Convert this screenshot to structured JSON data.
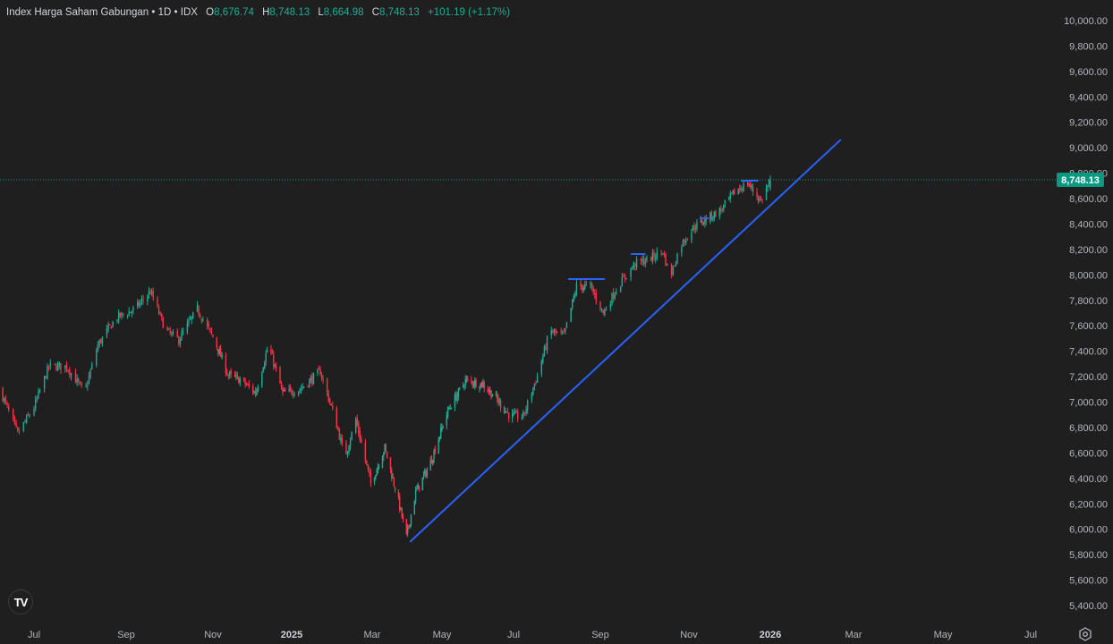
{
  "header": {
    "symbol": "Index Harga Saham Gabungan",
    "sep1": "•",
    "interval": "1D",
    "sep2": "•",
    "exchange": "IDX",
    "open_label": "O",
    "open": "8,676.74",
    "high_label": "H",
    "high": "8,748.13",
    "low_label": "L",
    "low": "8,664.98",
    "close_label": "C",
    "close": "8,748.13",
    "change": "+101.19 (+1.17%)"
  },
  "logo_text": "TV",
  "colors": {
    "background": "#1f1f1f",
    "up": "#22ab94",
    "down": "#f23645",
    "trendline": "#2962ff",
    "price_label": "#089981"
  },
  "icons": {
    "logo": "tradingview-logo-icon",
    "settings": "gear-icon"
  },
  "chart_data": {
    "type": "candlestick",
    "title": "",
    "ylim": [
      5300,
      10050
    ],
    "grid": false,
    "last_price": 8748.13,
    "last_price_label": "8,748.13",
    "y_ticks": [
      "10,000.00",
      "9,800.00",
      "9,600.00",
      "9,400.00",
      "9,200.00",
      "9,000.00",
      "8,800.00",
      "8,600.00",
      "8,400.00",
      "8,200.00",
      "8,000.00",
      "7,800.00",
      "7,600.00",
      "7,400.00",
      "7,200.00",
      "7,000.00",
      "6,800.00",
      "6,600.00",
      "6,400.00",
      "6,200.00",
      "6,000.00",
      "5,800.00",
      "5,600.00",
      "5,400.00"
    ],
    "x_ticks": [
      {
        "label": "Jul",
        "date": "2024-07-01"
      },
      {
        "label": "Sep",
        "date": "2024-09-01"
      },
      {
        "label": "Nov",
        "date": "2024-11-01"
      },
      {
        "label": "2025",
        "date": "2025-01-01",
        "bold": true
      },
      {
        "label": "Mar",
        "date": "2025-03-01"
      },
      {
        "label": "May",
        "date": "2025-05-01"
      },
      {
        "label": "Jul",
        "date": "2025-07-01"
      },
      {
        "label": "Sep",
        "date": "2025-09-01"
      },
      {
        "label": "Nov",
        "date": "2025-11-01"
      },
      {
        "label": "2026",
        "date": "2026-01-01",
        "bold": true
      },
      {
        "label": "Mar",
        "date": "2026-03-01"
      },
      {
        "label": "May",
        "date": "2026-05-01"
      },
      {
        "label": "Jul",
        "date": "2026-07-01"
      }
    ],
    "close_series": [
      [
        "2024-06-08",
        7100
      ],
      [
        "2024-06-20",
        6750
      ],
      [
        "2024-07-01",
        6960
      ],
      [
        "2024-07-11",
        7280
      ],
      [
        "2024-07-23",
        7280
      ],
      [
        "2024-08-04",
        7070
      ],
      [
        "2024-08-13",
        7450
      ],
      [
        "2024-08-25",
        7660
      ],
      [
        "2024-09-07",
        7730
      ],
      [
        "2024-09-18",
        7870
      ],
      [
        "2024-09-29",
        7560
      ],
      [
        "2024-10-08",
        7490
      ],
      [
        "2024-10-21",
        7730
      ],
      [
        "2024-11-02",
        7490
      ],
      [
        "2024-11-13",
        7210
      ],
      [
        "2024-11-23",
        7170
      ],
      [
        "2024-12-04",
        7070
      ],
      [
        "2024-12-14",
        7450
      ],
      [
        "2024-12-25",
        7070
      ],
      [
        "2025-01-07",
        7100
      ],
      [
        "2025-01-22",
        7240
      ],
      [
        "2025-02-02",
        6860
      ],
      [
        "2025-02-09",
        6570
      ],
      [
        "2025-02-17",
        6860
      ],
      [
        "2025-02-28",
        6360
      ],
      [
        "2025-03-12",
        6640
      ],
      [
        "2025-03-24",
        6220
      ],
      [
        "2025-03-31",
        5940
      ],
      [
        "2025-04-08",
        6290
      ],
      [
        "2025-04-20",
        6500
      ],
      [
        "2025-05-06",
        6930
      ],
      [
        "2025-05-21",
        7170
      ],
      [
        "2025-06-05",
        7140
      ],
      [
        "2025-06-16",
        7030
      ],
      [
        "2025-06-28",
        6890
      ],
      [
        "2025-07-08",
        6890
      ],
      [
        "2025-07-18",
        7210
      ],
      [
        "2025-07-27",
        7560
      ],
      [
        "2025-08-06",
        7520
      ],
      [
        "2025-08-15",
        7910
      ],
      [
        "2025-08-25",
        7910
      ],
      [
        "2025-09-03",
        7700
      ],
      [
        "2025-09-13",
        7910
      ],
      [
        "2025-09-25",
        8090
      ],
      [
        "2025-10-04",
        8120
      ],
      [
        "2025-10-14",
        8190
      ],
      [
        "2025-10-19",
        7980
      ],
      [
        "2025-10-26",
        8230
      ],
      [
        "2025-11-04",
        8370
      ],
      [
        "2025-11-14",
        8440
      ],
      [
        "2025-11-25",
        8510
      ],
      [
        "2025-12-05",
        8650
      ],
      [
        "2025-12-15",
        8720
      ],
      [
        "2025-12-25",
        8580
      ],
      [
        "2026-01-01",
        8748.13
      ]
    ],
    "drawings": {
      "trendline": {
        "start": [
          "2025-04-03",
          5900
        ],
        "end": [
          "2026-02-20",
          9064
        ]
      },
      "horizontal_levels": [
        {
          "from": "2025-08-09",
          "to": "2025-09-04",
          "price": 7967
        },
        {
          "from": "2025-09-22",
          "to": "2025-10-02",
          "price": 8164
        },
        {
          "from": "2025-11-09",
          "to": "2025-11-16",
          "price": 8445
        },
        {
          "from": "2025-12-10",
          "to": "2025-12-23",
          "price": 8741
        }
      ]
    }
  }
}
